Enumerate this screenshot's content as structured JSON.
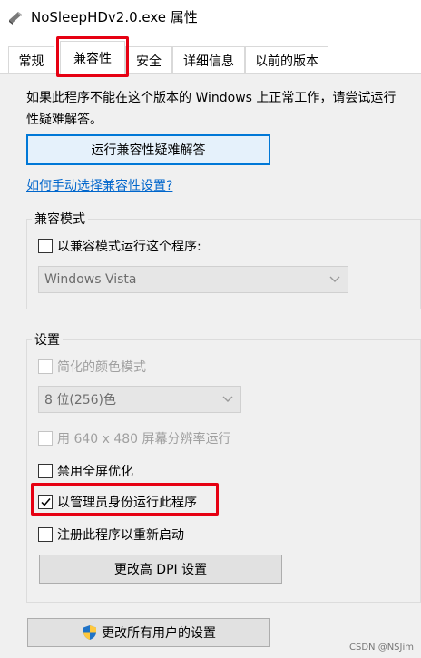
{
  "window": {
    "title": "NoSleepHDv2.0.exe 属性"
  },
  "tabs": [
    {
      "label": "常规"
    },
    {
      "label": "兼容性"
    },
    {
      "label": "安全"
    },
    {
      "label": "详细信息"
    },
    {
      "label": "以前的版本"
    }
  ],
  "intro": {
    "line1": "如果此程序不能在这个版本的 Windows 上正常工作，请尝试运行",
    "line2": "性疑难解答。"
  },
  "troubleshooter_button": "运行兼容性疑难解答",
  "manual_link": "如何手动选择兼容性设置?",
  "compat_mode": {
    "title": "兼容模式",
    "checkbox_label": "以兼容模式运行这个程序:",
    "selected_os": "Windows Vista"
  },
  "settings": {
    "title": "设置",
    "reduced_color": "简化的颜色模式",
    "color_value": "8 位(256)色",
    "res_640": "用 640 x 480 屏幕分辨率运行",
    "disable_fullscreen": "禁用全屏优化",
    "run_as_admin": "以管理员身份运行此程序",
    "register_restart": "注册此程序以重新启动",
    "dpi_button": "更改高 DPI 设置"
  },
  "all_users_button": "更改所有用户的设置",
  "watermark": "CSDN @NSJim",
  "checked": {
    "run_as_admin": true
  }
}
